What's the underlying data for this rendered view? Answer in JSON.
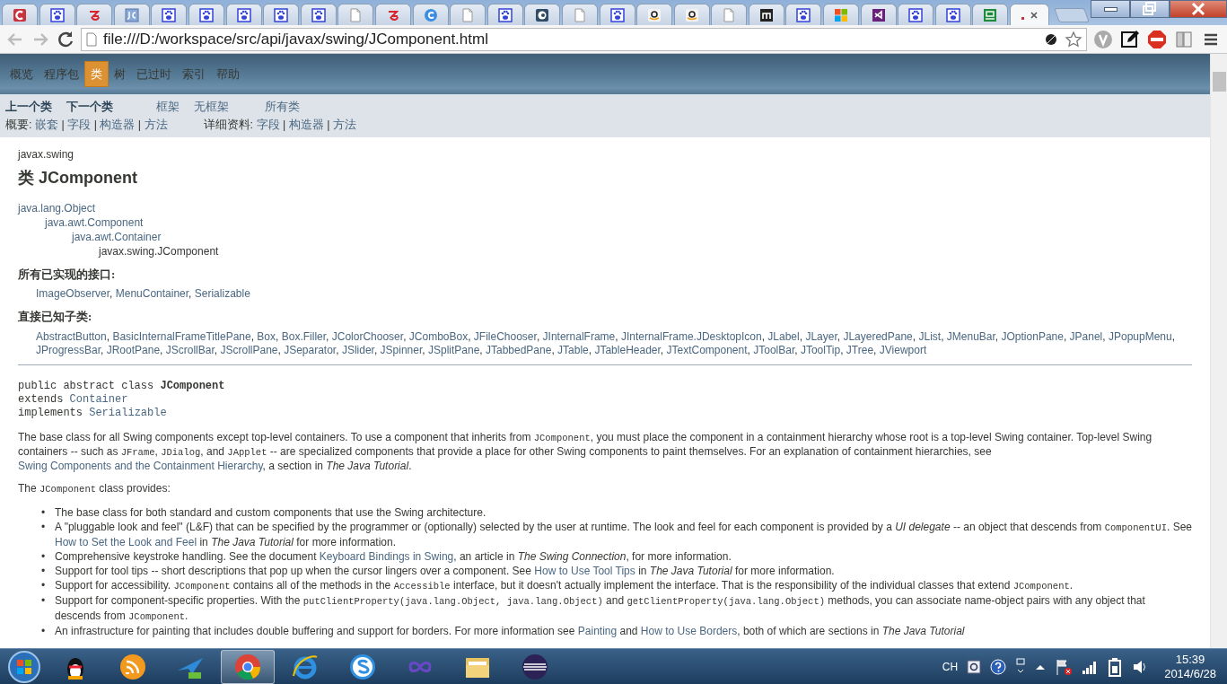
{
  "browser": {
    "tabs": [
      {
        "kind": "c-logo",
        "selected": false
      },
      {
        "kind": "paw",
        "selected": false
      },
      {
        "kind": "swirl",
        "selected": false
      },
      {
        "kind": "jc",
        "selected": false
      },
      {
        "kind": "paw",
        "selected": false
      },
      {
        "kind": "paw",
        "selected": false
      },
      {
        "kind": "paw",
        "selected": false
      },
      {
        "kind": "paw",
        "selected": false
      },
      {
        "kind": "paw",
        "selected": false
      },
      {
        "kind": "page",
        "selected": false
      },
      {
        "kind": "swirl",
        "selected": false
      },
      {
        "kind": "c-blue",
        "selected": false
      },
      {
        "kind": "page",
        "selected": false
      },
      {
        "kind": "paw",
        "selected": false
      },
      {
        "kind": "c-dark",
        "selected": false
      },
      {
        "kind": "page",
        "selected": false
      },
      {
        "kind": "paw",
        "selected": false
      },
      {
        "kind": "smile",
        "selected": false
      },
      {
        "kind": "smile",
        "selected": false
      },
      {
        "kind": "page",
        "selected": false
      },
      {
        "kind": "m-square",
        "selected": false
      },
      {
        "kind": "paw",
        "selected": false
      },
      {
        "kind": "windows",
        "selected": false
      },
      {
        "kind": "vs",
        "selected": false
      },
      {
        "kind": "paw",
        "selected": false
      },
      {
        "kind": "paw",
        "selected": false
      },
      {
        "kind": "green-box",
        "selected": false
      },
      {
        "kind": "dot",
        "selected": true
      }
    ],
    "address": "file:///D:/workspace/src/api/javax/swing/JComponent.html"
  },
  "doc_nav": {
    "top_items": [
      {
        "label": "概览",
        "selected": false
      },
      {
        "label": "程序包",
        "selected": false
      },
      {
        "label": "类",
        "selected": true
      },
      {
        "label": "树",
        "selected": false
      },
      {
        "label": "已过时",
        "selected": false
      },
      {
        "label": "索引",
        "selected": false
      },
      {
        "label": "帮助",
        "selected": false
      }
    ],
    "prev": "上一个类",
    "next": "下一个类",
    "frames": "框架",
    "no_frames": "无框架",
    "all_classes": "所有类",
    "summary": {
      "label": "概要:",
      "links": [
        "嵌套",
        "字段",
        "构造器",
        "方法"
      ]
    },
    "detail": {
      "label": "详细资料:",
      "links": [
        "字段",
        "构造器",
        "方法"
      ]
    },
    "separator": "|"
  },
  "content": {
    "package": "javax.swing",
    "title": "类 JComponent",
    "hierarchy": {
      "label": "java.lang.Object",
      "link": true,
      "children": [
        {
          "label": "java.awt.Component",
          "link": true,
          "children": [
            {
              "label": "java.awt.Container",
              "link": true,
              "children": [
                {
                  "label": "javax.swing.JComponent",
                  "link": false
                }
              ]
            }
          ]
        }
      ]
    },
    "interfaces": {
      "heading": "所有已实现的接口:",
      "items": [
        "ImageObserver",
        "MenuContainer",
        "Serializable"
      ]
    },
    "subclasses": {
      "heading": "直接已知子类:",
      "items": [
        "AbstractButton",
        "BasicInternalFrameTitlePane",
        "Box",
        "Box.Filler",
        "JColorChooser",
        "JComboBox",
        "JFileChooser",
        "JInternalFrame",
        "JInternalFrame.JDesktopIcon",
        "JLabel",
        "JLayer",
        "JLayeredPane",
        "JList",
        "JMenuBar",
        "JOptionPane",
        "JPanel",
        "JPopupMenu",
        "JProgressBar",
        "JRootPane",
        "JScrollBar",
        "JScrollPane",
        "JSeparator",
        "JSlider",
        "JSpinner",
        "JSplitPane",
        "JTabbedPane",
        "JTable",
        "JTableHeader",
        "JTextComponent",
        "JToolBar",
        "JToolTip",
        "JTree",
        "JViewport"
      ]
    },
    "list_separator": ", ",
    "bullet": "•",
    "declaration": [
      [
        {
          "kind": "text",
          "text": "public abstract class "
        },
        {
          "kind": "bold",
          "text": "JComponent"
        }
      ],
      [
        {
          "kind": "text",
          "text": "extends "
        },
        {
          "kind": "link",
          "text": "Container"
        }
      ],
      [
        {
          "kind": "text",
          "text": "implements "
        },
        {
          "kind": "link",
          "text": "Serializable"
        }
      ]
    ],
    "paragraphs": [
      [
        {
          "kind": "text",
          "text": "The base class for all Swing components except top-level containers. To use a component that inherits from "
        },
        {
          "kind": "code",
          "text": "JComponent"
        },
        {
          "kind": "text",
          "text": ", you must place the component in a containment hierarchy whose root is a top-level Swing container. Top-level Swing containers -- such as "
        },
        {
          "kind": "code",
          "text": "JFrame"
        },
        {
          "kind": "text",
          "text": ", "
        },
        {
          "kind": "code",
          "text": "JDialog"
        },
        {
          "kind": "text",
          "text": ", and "
        },
        {
          "kind": "code",
          "text": "JApplet"
        },
        {
          "kind": "text",
          "text": " -- are specialized components that provide a place for other Swing components to paint themselves. For an explanation of containment hierarchies, see "
        },
        {
          "kind": "link",
          "text": "Swing Components and the Containment Hierarchy"
        },
        {
          "kind": "text",
          "text": ", a section in "
        },
        {
          "kind": "em",
          "text": "The Java Tutorial"
        },
        {
          "kind": "text",
          "text": "."
        }
      ],
      [
        {
          "kind": "text",
          "text": "The "
        },
        {
          "kind": "code",
          "text": "JComponent"
        },
        {
          "kind": "text",
          "text": " class provides:"
        }
      ]
    ],
    "bullets": [
      [
        {
          "kind": "text",
          "text": "The base class for both standard and custom components that use the Swing architecture."
        }
      ],
      [
        {
          "kind": "text",
          "text": "A \"pluggable look and feel\" (L&F) that can be specified by the programmer or (optionally) selected by the user at runtime. The look and feel for each component is provided by a "
        },
        {
          "kind": "em",
          "text": "UI delegate"
        },
        {
          "kind": "text",
          "text": " -- an object that descends from "
        },
        {
          "kind": "code",
          "text": "ComponentUI"
        },
        {
          "kind": "text",
          "text": ". See "
        },
        {
          "kind": "link",
          "text": "How to Set the Look and Feel"
        },
        {
          "kind": "text",
          "text": " in "
        },
        {
          "kind": "em",
          "text": "The Java Tutorial"
        },
        {
          "kind": "text",
          "text": " for more information."
        }
      ],
      [
        {
          "kind": "text",
          "text": "Comprehensive keystroke handling. See the document "
        },
        {
          "kind": "link",
          "text": "Keyboard Bindings in Swing"
        },
        {
          "kind": "text",
          "text": ", an article in "
        },
        {
          "kind": "em",
          "text": "The Swing Connection"
        },
        {
          "kind": "text",
          "text": ", for more information."
        }
      ],
      [
        {
          "kind": "text",
          "text": "Support for tool tips -- short descriptions that pop up when the cursor lingers over a component. See "
        },
        {
          "kind": "link",
          "text": "How to Use Tool Tips"
        },
        {
          "kind": "text",
          "text": " in "
        },
        {
          "kind": "em",
          "text": "The Java Tutorial"
        },
        {
          "kind": "text",
          "text": " for more information."
        }
      ],
      [
        {
          "kind": "text",
          "text": "Support for accessibility. "
        },
        {
          "kind": "code",
          "text": "JComponent"
        },
        {
          "kind": "text",
          "text": " contains all of the methods in the "
        },
        {
          "kind": "code",
          "text": "Accessible"
        },
        {
          "kind": "text",
          "text": " interface, but it doesn't actually implement the interface. That is the responsibility of the individual classes that extend "
        },
        {
          "kind": "code",
          "text": "JComponent"
        },
        {
          "kind": "text",
          "text": "."
        }
      ],
      [
        {
          "kind": "text",
          "text": "Support for component-specific properties. With the "
        },
        {
          "kind": "code",
          "text": "putClientProperty(java.lang.Object, java.lang.Object)"
        },
        {
          "kind": "text",
          "text": " and "
        },
        {
          "kind": "code",
          "text": "getClientProperty(java.lang.Object)"
        },
        {
          "kind": "text",
          "text": " methods, you can associate name-object pairs with any object that descends from "
        },
        {
          "kind": "code",
          "text": "JComponent"
        },
        {
          "kind": "text",
          "text": "."
        }
      ],
      [
        {
          "kind": "text",
          "text": "An infrastructure for painting that includes double buffering and support for borders. For more information see "
        },
        {
          "kind": "link",
          "text": "Painting"
        },
        {
          "kind": "text",
          "text": " and "
        },
        {
          "kind": "link",
          "text": "How to Use Borders"
        },
        {
          "kind": "text",
          "text": ", both of which are sections in "
        },
        {
          "kind": "em",
          "text": "The Java Tutorial"
        }
      ]
    ]
  },
  "taskbar": {
    "apps": [
      {
        "kind": "penguin",
        "selected": false
      },
      {
        "kind": "feed",
        "selected": false
      },
      {
        "kind": "bird",
        "selected": false
      },
      {
        "kind": "chrome",
        "selected": true
      },
      {
        "kind": "ie",
        "selected": false
      },
      {
        "kind": "s-circle",
        "selected": false
      },
      {
        "kind": "infinity",
        "selected": false
      },
      {
        "kind": "folder",
        "selected": false
      },
      {
        "kind": "eclipse",
        "selected": false
      }
    ],
    "language": "CH",
    "time": "15:39",
    "date": "2014/6/28"
  }
}
